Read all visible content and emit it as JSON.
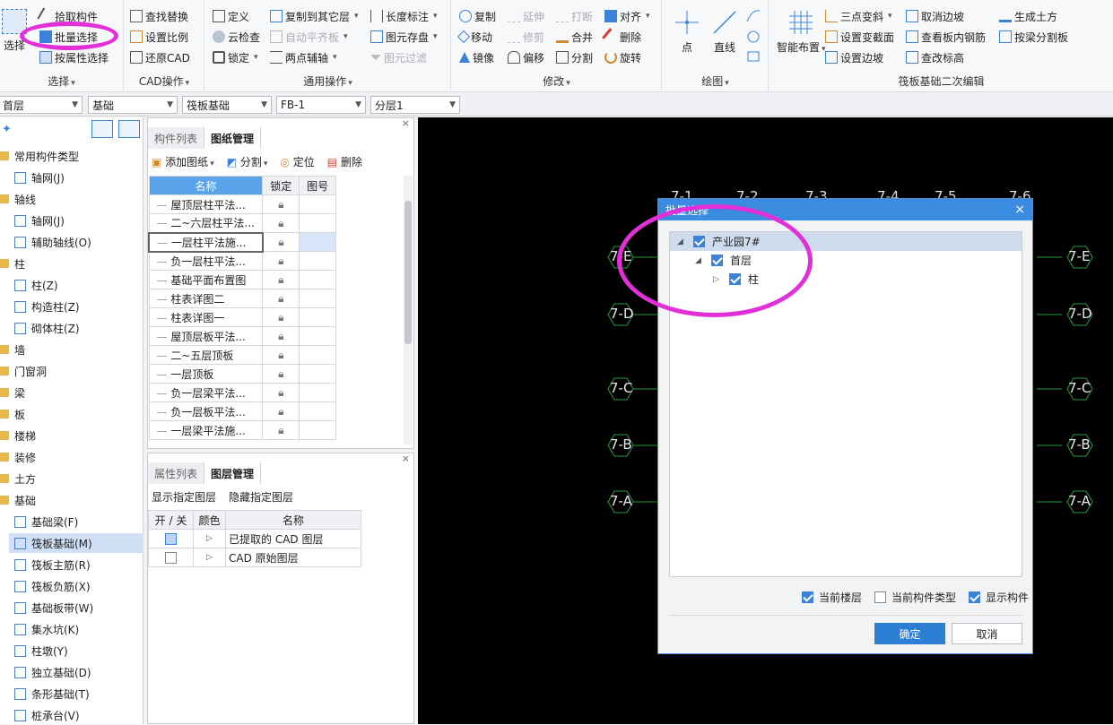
{
  "ribbon": {
    "select": {
      "big": "选择",
      "items": [
        "拾取构件",
        "批量选择",
        "按属性选择"
      ],
      "label": "选择"
    },
    "cad": {
      "items": [
        "查找替换",
        "设置比例",
        "还原CAD"
      ],
      "label": "CAD操作"
    },
    "common": {
      "items": [
        "定义",
        "云检查",
        "锁定",
        "复制到其它层",
        "自动平齐板",
        "两点辅轴",
        "长度标注",
        "图元存盘",
        "图元过滤"
      ],
      "label": "通用操作"
    },
    "modify": {
      "items": [
        "复制",
        "延伸",
        "打断",
        "对齐",
        "移动",
        "修剪",
        "合并",
        "删除",
        "镜像",
        "偏移",
        "分割",
        "旋转"
      ],
      "label": "修改"
    },
    "draw": {
      "items": [
        "点",
        "直线"
      ],
      "label": "绘图"
    },
    "raft": {
      "big": "智能布置",
      "items": [
        "三点变斜",
        "设置变截面",
        "设置边坡",
        "取消边坡",
        "查看板内钢筋",
        "查改标高",
        "生成土方",
        "按梁分割板"
      ],
      "label": "筏板基础二次编辑"
    }
  },
  "selectors": [
    "首层",
    "基础",
    "筏板基础",
    "FB-1",
    "分层1"
  ],
  "tree": [
    {
      "label": "常用构件类型",
      "type": "folder"
    },
    {
      "label": "轴网(J)",
      "type": "item"
    },
    {
      "label": "轴线",
      "type": "folder"
    },
    {
      "label": "轴网(J)",
      "type": "item"
    },
    {
      "label": "辅助轴线(O)",
      "type": "item"
    },
    {
      "label": "柱",
      "type": "folder"
    },
    {
      "label": "柱(Z)",
      "type": "item"
    },
    {
      "label": "构造柱(Z)",
      "type": "item"
    },
    {
      "label": "砌体柱(Z)",
      "type": "item"
    },
    {
      "label": "墙",
      "type": "folder"
    },
    {
      "label": "门窗洞",
      "type": "folder"
    },
    {
      "label": "梁",
      "type": "folder"
    },
    {
      "label": "板",
      "type": "folder"
    },
    {
      "label": "楼梯",
      "type": "folder"
    },
    {
      "label": "装修",
      "type": "folder"
    },
    {
      "label": "土方",
      "type": "folder"
    },
    {
      "label": "基础",
      "type": "folder"
    },
    {
      "label": "基础梁(F)",
      "type": "item"
    },
    {
      "label": "筏板基础(M)",
      "type": "item",
      "selected": true
    },
    {
      "label": "筏板主筋(R)",
      "type": "item"
    },
    {
      "label": "筏板负筋(X)",
      "type": "item"
    },
    {
      "label": "基础板带(W)",
      "type": "item"
    },
    {
      "label": "集水坑(K)",
      "type": "item"
    },
    {
      "label": "柱墩(Y)",
      "type": "item"
    },
    {
      "label": "独立基础(D)",
      "type": "item"
    },
    {
      "label": "条形基础(T)",
      "type": "item"
    },
    {
      "label": "桩承台(V)",
      "type": "item"
    }
  ],
  "drawings": {
    "tabs": [
      "构件列表",
      "图纸管理"
    ],
    "toolbar": [
      "添加图纸",
      "分割",
      "定位",
      "删除"
    ],
    "headers": [
      "名称",
      "锁定",
      "图号"
    ],
    "rows": [
      "屋顶层柱平法...",
      "二~六层柱平法...",
      "一层柱平法施...",
      "负一层柱平法...",
      "基础平面布置图",
      "柱表详图二",
      "柱表详图一",
      "屋顶层板平法...",
      "二~五层顶板",
      "一层顶板",
      "负一层梁平法...",
      "负一层板平法...",
      "一层梁平法施..."
    ]
  },
  "layers": {
    "tabs": [
      "属性列表",
      "图层管理"
    ],
    "toolbar": [
      "显示指定图层",
      "隐藏指定图层"
    ],
    "headers": [
      "开 / 关",
      "颜色",
      "名称"
    ],
    "rows": [
      "已提取的 CAD 图层",
      "CAD 原始图层"
    ]
  },
  "canvas": {
    "axes_left": [
      "7-E",
      "7-D",
      "7-C",
      "7-B",
      "7-A"
    ],
    "axes_right": [
      "7-E",
      "7-D",
      "7-C",
      "7-B",
      "7-A"
    ],
    "axes_top": [
      "7-1",
      "7-2",
      "7-3",
      "7-4",
      "7-5",
      "7-6"
    ]
  },
  "dialog": {
    "title": "批量选择",
    "tree": [
      {
        "label": "产业园7#",
        "level": 0,
        "checked": true
      },
      {
        "label": "首层",
        "level": 1,
        "checked": true
      },
      {
        "label": "柱",
        "level": 2,
        "checked": true
      }
    ],
    "options": [
      {
        "label": "当前楼层",
        "checked": true
      },
      {
        "label": "当前构件类型",
        "checked": false
      },
      {
        "label": "显示构件",
        "checked": true
      }
    ],
    "ok": "确定",
    "cancel": "取消"
  },
  "colors": {
    "accent": "#3b8be0",
    "annotation": "#e22fd8",
    "canvas": "#000000"
  }
}
